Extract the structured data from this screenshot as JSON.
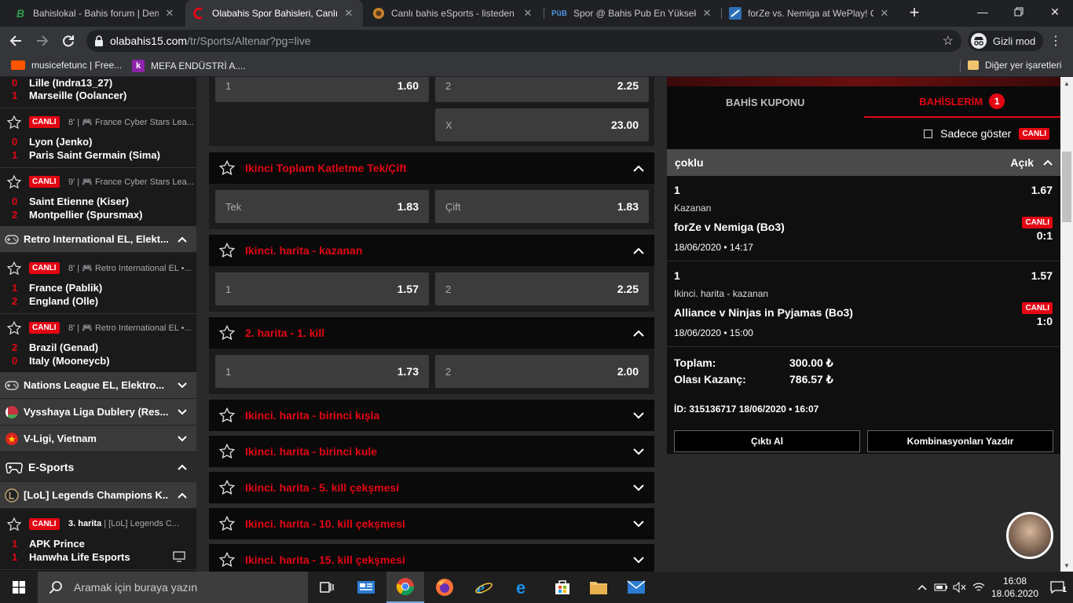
{
  "browser": {
    "tabs": [
      {
        "title": "Bahislokal - Bahis forum | Dene",
        "fav": "B",
        "favcolor": "#2f9e4f"
      },
      {
        "title": "Olabahis Spor Bahisleri, Canlı B",
        "fav": "C",
        "favcolor": "#e30613"
      },
      {
        "title": "Canlı bahis eSports - listeden o",
        "fav": "",
        "favcolor": "#c9822b"
      },
      {
        "title": "Spor @ Bahis Pub En Yüksek B",
        "fav": "PüB",
        "favcolor": "#4a90d9"
      },
      {
        "title": "forZe vs. Nemiga at WePlay! Cl",
        "fav": "",
        "favcolor": "#2d6fb5"
      }
    ],
    "url_domain": "olabahis15.com",
    "url_path": "/tr/Sports/Altenar?pg=live",
    "incognito_label": "Gizli mod",
    "bookmarks": [
      {
        "label": "musicefetunc | Free...",
        "color": "#ff5500"
      },
      {
        "label": "MEFA ENDÜSTRİ A....",
        "icon": "k",
        "color": "#8e24aa"
      }
    ],
    "other_bookmarks": "Diğer yer işaretleri"
  },
  "sidebar": {
    "partial_event": {
      "s1": "0",
      "t1": "Lille (Indra13_27)",
      "s2": "1",
      "t2": "Marseille (Oolancer)"
    },
    "events": [
      {
        "live": "CANLI",
        "meta": "8' | 🎮 France Cyber Stars Lea...",
        "s1": "0",
        "t1": "Lyon (Jenko)",
        "s2": "1",
        "t2": "Paris Saint Germain (Sima)"
      },
      {
        "live": "CANLI",
        "meta": "9' | 🎮 France Cyber Stars Lea...",
        "s1": "0",
        "t1": "Saint Etienne (Kiser)",
        "s2": "2",
        "t2": "Montpellier (Spursmax)"
      }
    ],
    "league_retro": "Retro International EL, Elekt...",
    "events_retro": [
      {
        "live": "CANLI",
        "meta": "8' | 🎮 Retro International EL  •...",
        "s1": "1",
        "t1": "France (Pablik)",
        "s2": "2",
        "t2": "England (Olle)"
      },
      {
        "live": "CANLI",
        "meta": "8' | 🎮 Retro International EL  •...",
        "s1": "2",
        "t1": "Brazil (Genad)",
        "s2": "0",
        "t2": "Italy (Mooneycb)"
      }
    ],
    "leagues": [
      "Nations League EL, Elektro...",
      "Vysshaya Liga Dublery (Res...",
      "V-Ligi, Vietnam"
    ],
    "esports": "E-Sports",
    "lol_league": "[LoL] Legends Champions K...",
    "lol_event": {
      "live": "CANLI",
      "period": "3. harita",
      "meta": "| [LoL] Legends C...",
      "s1": "1",
      "t1": "APK Prince",
      "s2": "1",
      "t2": "Hanwha Life Esports"
    }
  },
  "markets": {
    "top": [
      {
        "label": "1",
        "odd": "1.60"
      },
      {
        "label": "2",
        "odd": "2.25"
      },
      {
        "label": "X",
        "odd": "23.00"
      }
    ],
    "expanded": [
      {
        "title": "Ikinci Toplam Katletme Tek/Çift",
        "options": [
          {
            "label": "Tek",
            "odd": "1.83"
          },
          {
            "label": "Çift",
            "odd": "1.83"
          }
        ]
      },
      {
        "title": "Ikinci. harita - kazanan",
        "options": [
          {
            "label": "1",
            "odd": "1.57"
          },
          {
            "label": "2",
            "odd": "2.25"
          }
        ]
      },
      {
        "title": "2. harita - 1. kill",
        "options": [
          {
            "label": "1",
            "odd": "1.73"
          },
          {
            "label": "2",
            "odd": "2.00"
          }
        ]
      }
    ],
    "collapsed": [
      "Ikinci. harita - birinci kışla",
      "Ikinci. harita - birinci kule",
      "Ikinci. harita - 5. kill çekşmesi",
      "Ikinci. harita - 10. kill çekşmesi",
      "Ikinci. harita - 15. kill çekşmesi"
    ]
  },
  "coupon": {
    "tab1": "BAHİS KUPONU",
    "tab2": "BAHİSLERİM",
    "badge": "1",
    "filter_label": "Sadece göster",
    "filter_live": "CANLI",
    "type": "çoklu",
    "status": "Açık",
    "selections": [
      {
        "pick": "1",
        "odd": "1.67",
        "market": "Kazanan",
        "match": "forZe v Nemiga (Bo3)",
        "live": "CANLI",
        "score": "0:1",
        "date": "18/06/2020 • 14:17"
      },
      {
        "pick": "1",
        "odd": "1.57",
        "market": "Ikinci. harita - kazanan",
        "match": "Alliance v Ninjas in Pyjamas (Bo3)",
        "live": "CANLI",
        "score": "1:0",
        "date": "18/06/2020 • 15:00"
      }
    ],
    "total_label": "Toplam:",
    "total_value": "300.00 ₺",
    "win_label": "Olası Kazanç:",
    "win_value": "786.57 ₺",
    "id_line": "İD: 315136717  18/06/2020 • 16:07",
    "btn_print": "Çıktı Al",
    "btn_combos": "Kombinasyonları Yazdır"
  },
  "taskbar": {
    "search_placeholder": "Aramak için buraya yazın",
    "time": "16:08",
    "date": "18.06.2020",
    "notifications": "1"
  },
  "colors": {
    "accent": "#e30613",
    "bg": "#2a2a2a",
    "panel": "#0a0a0a",
    "odd_btn": "#3c3c3c"
  }
}
